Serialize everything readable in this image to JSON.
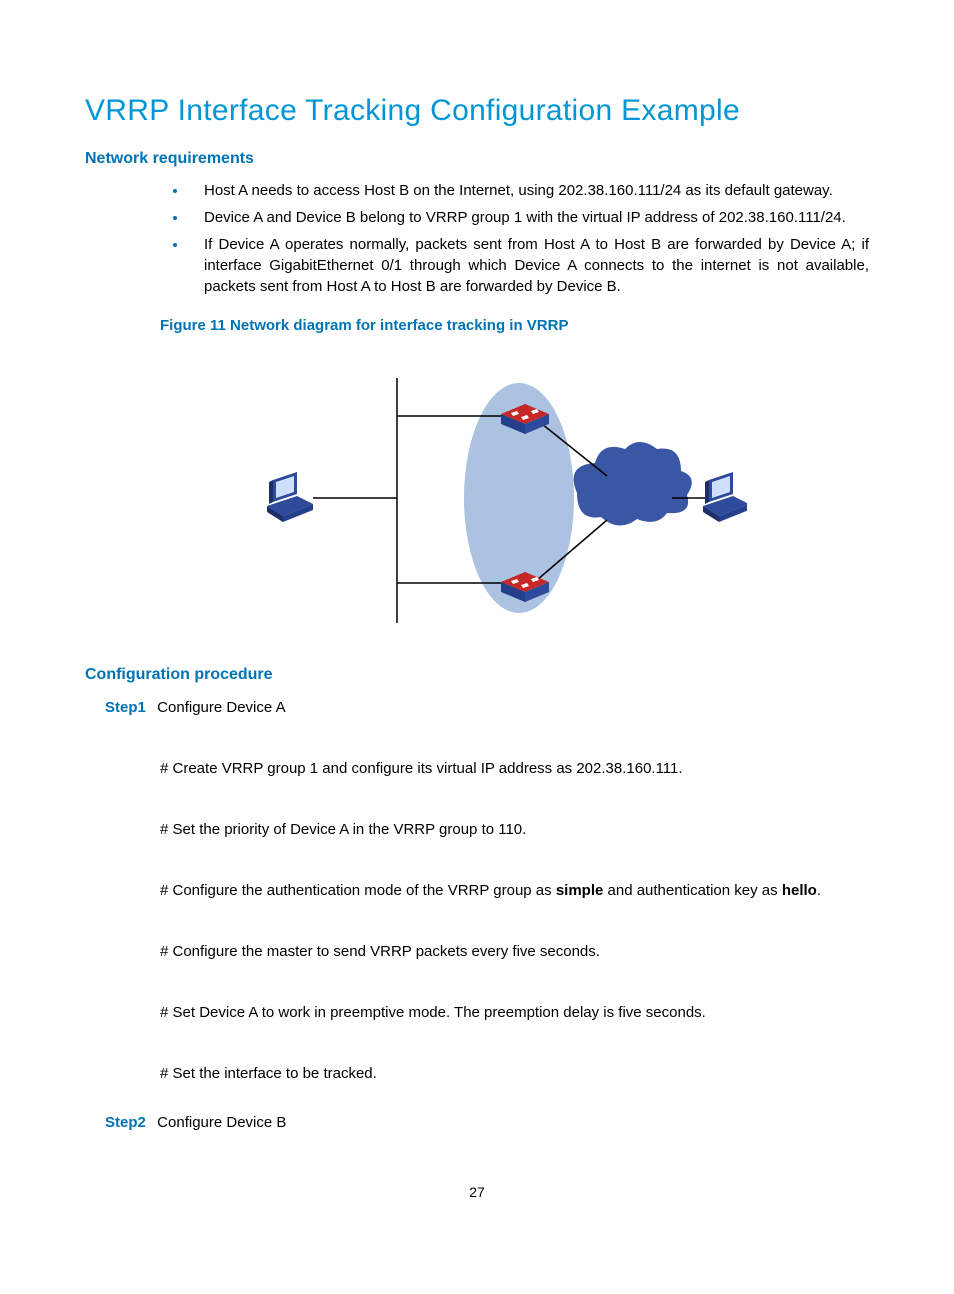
{
  "title": "VRRP Interface Tracking Configuration Example",
  "section1": {
    "heading": "Network requirements",
    "bullets": [
      "Host A needs to access Host B on the Internet, using 202.38.160.111/24 as its default gateway.",
      "Device A and Device B belong to VRRP group 1 with the virtual IP address of 202.38.160.111/24.",
      "If Device A operates normally, packets sent from Host A to Host B are forwarded by Device A; if interface GigabitEthernet 0/1 through which Device A connects to the internet is not available, packets sent from Host A to Host B are forwarded by Device B."
    ],
    "figure_caption": "Figure 11 Network diagram for interface tracking in VRRP"
  },
  "section2": {
    "heading": "Configuration procedure",
    "step1": {
      "label": "Step1",
      "text": "Configure Device A",
      "items": [
        "# Create VRRP group 1 and configure its virtual IP address as 202.38.160.111.",
        "# Set the priority of Device A in the VRRP group to 110.",
        {
          "prefix": "# Configure the authentication mode of the VRRP group as ",
          "b1": "simple",
          "mid": " and authentication key as ",
          "b2": "hello",
          "suffix": "."
        },
        "# Configure the master to send VRRP packets every five seconds.",
        "# Set Device A to work in preemptive mode. The preemption delay is five seconds.",
        "# Set the interface to be tracked."
      ]
    },
    "step2": {
      "label": "Step2",
      "text": "Configure Device B"
    }
  },
  "pagenum": "27"
}
